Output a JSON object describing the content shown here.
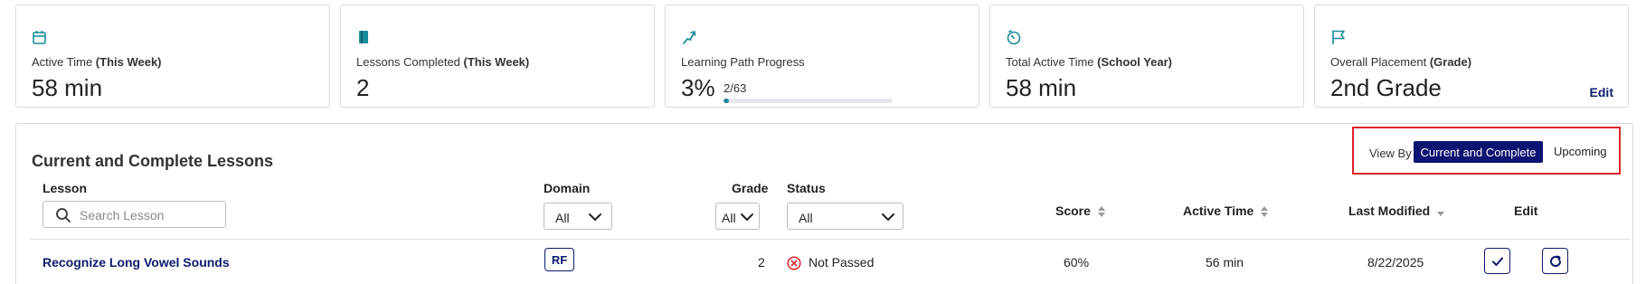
{
  "cards": [
    {
      "icon": "calendar-icon",
      "label": "Active Time ",
      "label_bold": "(This Week)",
      "value": "58 min"
    },
    {
      "icon": "book-icon",
      "label": "Lessons Completed ",
      "label_bold": "(This Week)",
      "value": "2"
    },
    {
      "icon": "path-icon",
      "label": "Learning Path Progress",
      "label_bold": "",
      "value": "3%",
      "sub": "2/63",
      "progress": 0.03
    },
    {
      "icon": "timer-icon",
      "label": "Total Active Time ",
      "label_bold": "(School Year)",
      "value": "58 min"
    },
    {
      "icon": "flag-icon",
      "label": "Overall Placement ",
      "label_bold": "(Grade)",
      "value": "2nd Grade",
      "edit": "Edit"
    }
  ],
  "panel": {
    "title": "Current and Complete Lessons",
    "view_by": {
      "label": "View By",
      "active": "Current and Complete",
      "other": "Upcoming"
    }
  },
  "columns": {
    "lesson": "Lesson",
    "domain": "Domain",
    "grade": "Grade",
    "status": "Status",
    "score": "Score",
    "active_time": "Active Time",
    "last_modified": "Last Modified",
    "edit": "Edit"
  },
  "filters": {
    "search_placeholder": "Search Lesson",
    "domain": "All",
    "grade": "All",
    "status": "All"
  },
  "rows": [
    {
      "lesson": "Recognize Long Vowel Sounds",
      "domain": "RF",
      "grade": "2",
      "status": "Not Passed",
      "score": "60%",
      "active_time": "56 min",
      "last_modified": "8/22/2025"
    }
  ],
  "colors": {
    "accent": "#0d1370",
    "teal": "#1b8a9b",
    "highlight": "#e0242a",
    "error": "#e0242a"
  }
}
